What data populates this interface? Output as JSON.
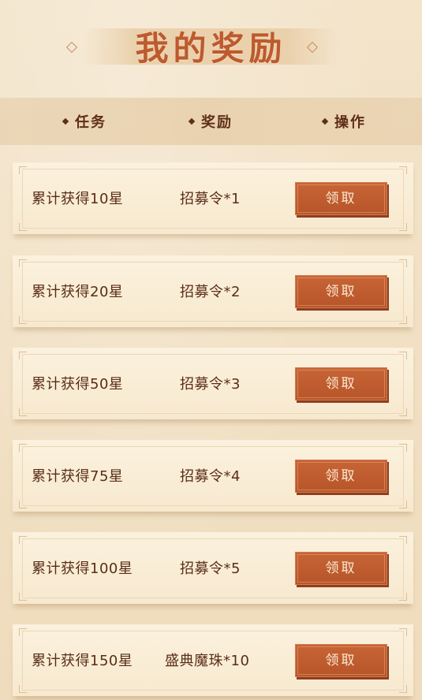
{
  "title": "我的奖励",
  "columns": {
    "task": "任务",
    "reward": "奖励",
    "action": "操作"
  },
  "rows": [
    {
      "task": "累计获得10星",
      "reward": "招募令*1",
      "button": "领取"
    },
    {
      "task": "累计获得20星",
      "reward": "招募令*2",
      "button": "领取"
    },
    {
      "task": "累计获得50星",
      "reward": "招募令*3",
      "button": "领取"
    },
    {
      "task": "累计获得75星",
      "reward": "招募令*4",
      "button": "领取"
    },
    {
      "task": "累计获得100星",
      "reward": "招募令*5",
      "button": "领取"
    },
    {
      "task": "累计获得150星",
      "reward": "盛典魔珠*10",
      "button": "领取"
    }
  ],
  "colors": {
    "accent": "#bd5a2e",
    "button": "#c0602f",
    "text": "#5a2d17",
    "background": "#f1e1c6"
  }
}
